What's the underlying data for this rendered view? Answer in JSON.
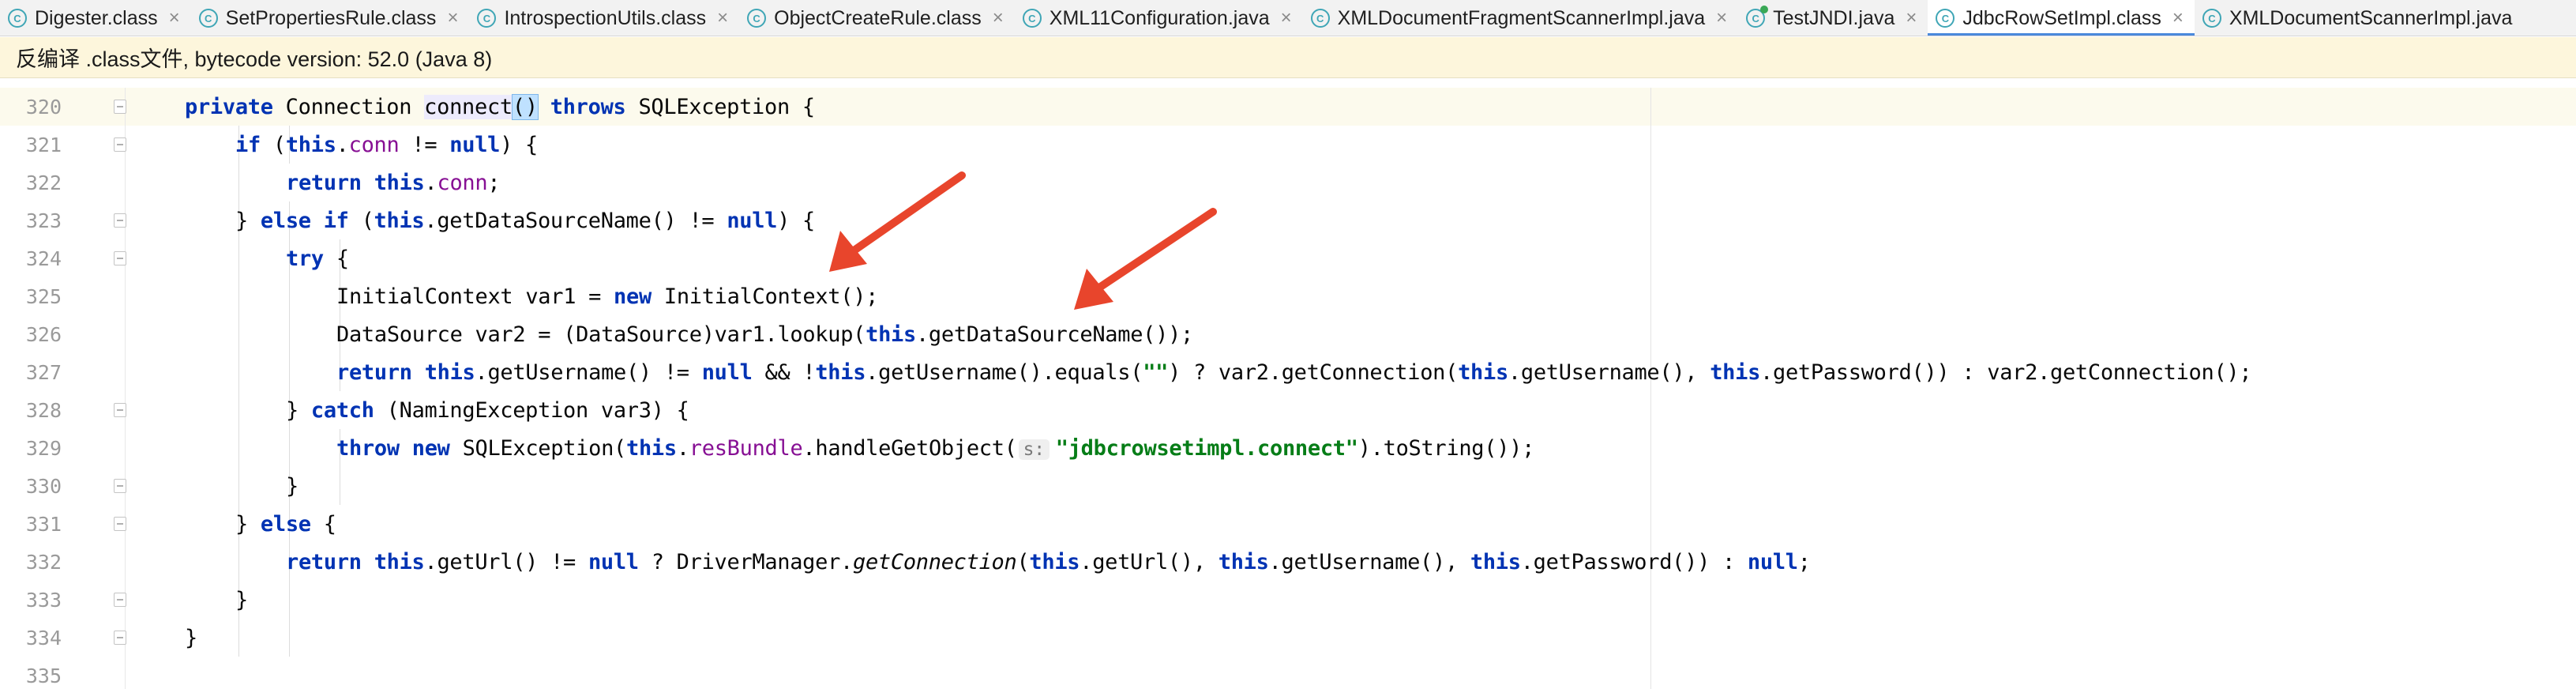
{
  "tabs": [
    {
      "label": "Digester.class",
      "active": false,
      "icon": "class-icon"
    },
    {
      "label": "SetPropertiesRule.class",
      "active": false,
      "icon": "class-icon"
    },
    {
      "label": "IntrospectionUtils.class",
      "active": false,
      "icon": "class-icon"
    },
    {
      "label": "ObjectCreateRule.class",
      "active": false,
      "icon": "class-icon"
    },
    {
      "label": "XML11Configuration.java",
      "active": false,
      "icon": "class-icon"
    },
    {
      "label": "XMLDocumentFragmentScannerImpl.java",
      "active": false,
      "icon": "class-icon"
    },
    {
      "label": "TestJNDI.java",
      "active": false,
      "icon": "test-class-icon"
    },
    {
      "label": "JdbcRowSetImpl.class",
      "active": true,
      "icon": "class-icon"
    },
    {
      "label": "XMLDocumentScannerImpl.java",
      "active": false,
      "icon": "class-icon"
    }
  ],
  "tab_close_glyph": "×",
  "banner": {
    "text": "反编译 .class文件, bytecode version: 52.0 (Java 8)"
  },
  "editor": {
    "line_numbers": [
      "320",
      "321",
      "322",
      "323",
      "324",
      "325",
      "326",
      "327",
      "328",
      "329",
      "330",
      "331",
      "332",
      "333",
      "334",
      "335"
    ],
    "param_hint": "s:",
    "string_literal": "\"jdbcrowsetimpl.connect\""
  },
  "colors": {
    "keyword": "#0033b3",
    "field": "#871094",
    "string": "#067d17",
    "arrow": "#e8452c",
    "active_tab_underline": "#4a89dc"
  }
}
